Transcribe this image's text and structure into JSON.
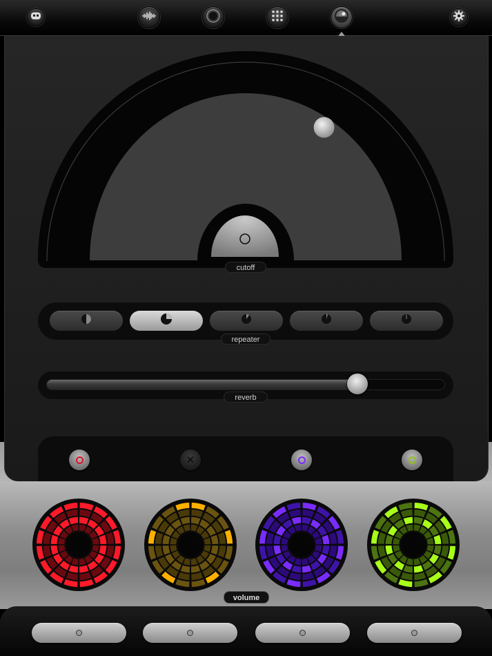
{
  "nav": {
    "items": [
      {
        "icon": "robot-face-icon",
        "active": false
      },
      {
        "icon": "waveform-icon",
        "active": false
      },
      {
        "icon": "record-icon",
        "active": false
      },
      {
        "icon": "grid-dots-icon",
        "active": false
      },
      {
        "icon": "effects-dial-icon",
        "active": true
      },
      {
        "icon": "gear-icon",
        "active": false
      }
    ]
  },
  "cutoff": {
    "label": "cutoff",
    "value": 0.68
  },
  "repeater": {
    "label": "repeater",
    "selected_index": 1,
    "options": [
      {
        "icon": "half-circle-icon"
      },
      {
        "icon": "three-quarter-circle-icon"
      },
      {
        "icon": "quarter-tick-icon"
      },
      {
        "icon": "small-tick-icon"
      },
      {
        "icon": "thin-tick-icon"
      }
    ]
  },
  "reverb": {
    "label": "reverb",
    "value": 0.78
  },
  "selectors": [
    {
      "icon": "red-ring-icon",
      "color": "#e0102a",
      "active": true
    },
    {
      "icon": "close-x-icon",
      "color": "#0a0a0a",
      "active": false
    },
    {
      "icon": "purple-ring-icon",
      "color": "#7a2cff",
      "active": true
    },
    {
      "icon": "green-ring-icon",
      "color": "#8ec21a",
      "active": true
    }
  ],
  "volume": {
    "label": "volume",
    "dials": [
      {
        "name": "red",
        "base": "#6a0a10",
        "mid": "#a01018",
        "lit": "#ff1a2a",
        "pattern": "full"
      },
      {
        "name": "amber",
        "base": "#4a3a08",
        "mid": "#6a5410",
        "lit": "#ffb000",
        "pattern": "sparse"
      },
      {
        "name": "purple",
        "base": "#2c0a7a",
        "mid": "#3e14a8",
        "lit": "#7a2cff",
        "pattern": "medium"
      },
      {
        "name": "green",
        "base": "#3a5a08",
        "mid": "#4c7410",
        "lit": "#a8ff1a",
        "pattern": "medium"
      }
    ]
  },
  "pads": [
    {
      "icon": "pad-dot-icon"
    },
    {
      "icon": "pad-dot-icon"
    },
    {
      "icon": "pad-dot-icon"
    },
    {
      "icon": "pad-dot-icon"
    }
  ]
}
